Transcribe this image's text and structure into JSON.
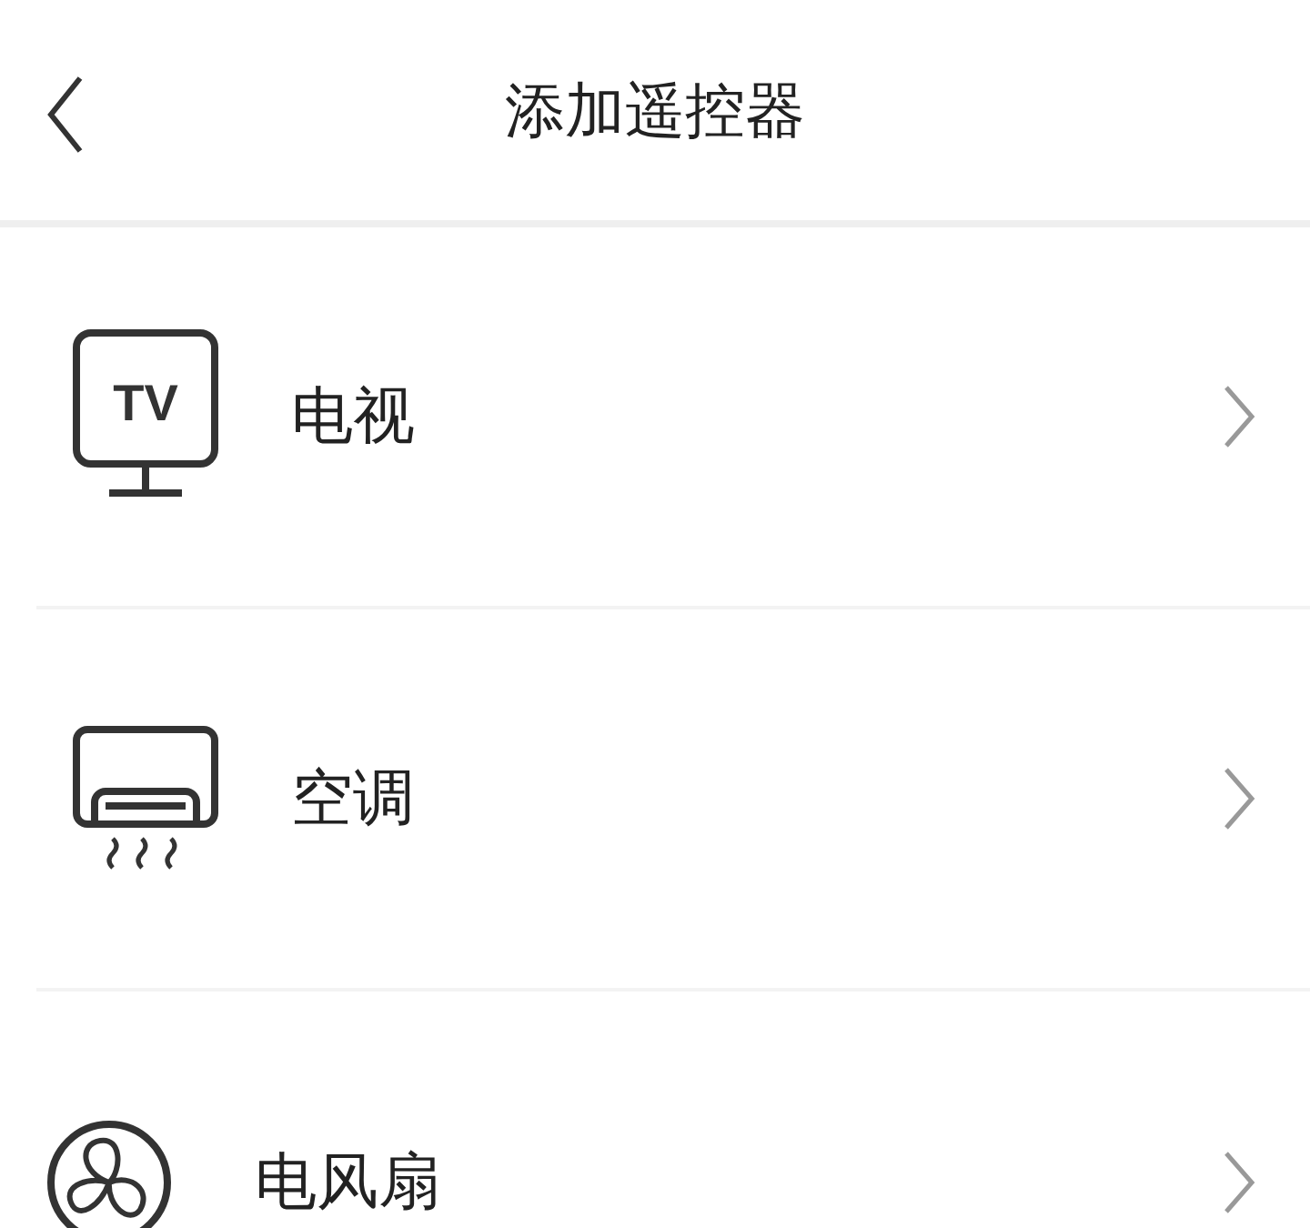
{
  "header": {
    "title": "添加遥控器"
  },
  "items": [
    {
      "kind": "tv",
      "label": "电视",
      "icon_text": "TV"
    },
    {
      "kind": "ac",
      "label": "空调"
    },
    {
      "kind": "fan",
      "label": "电风扇"
    }
  ]
}
